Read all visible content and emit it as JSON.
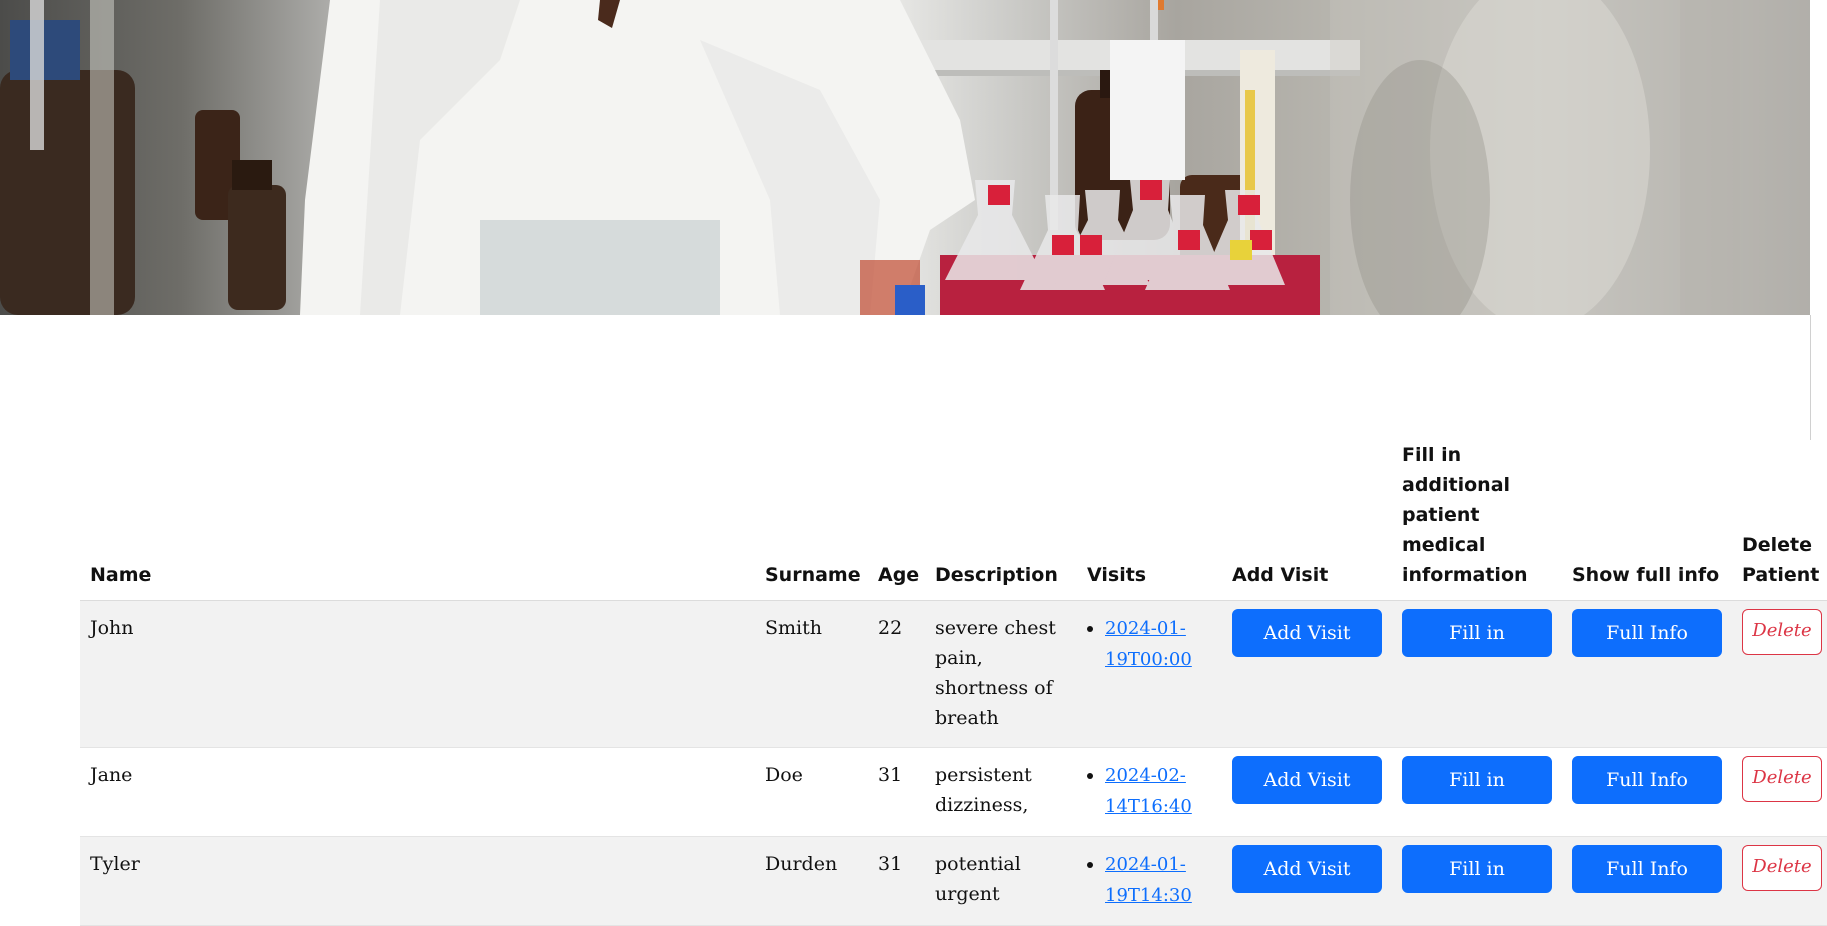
{
  "banner": {
    "alt": "laboratory"
  },
  "table": {
    "headers": {
      "name": "Name",
      "surname": "Surname",
      "age": "Age",
      "description": "Description",
      "visits": "Visits",
      "add_visit": "Add Visit",
      "fill_in": "Fill in additional patient medical information",
      "show_full_info": "Show full info",
      "delete": "Delete Patient"
    },
    "rows": [
      {
        "name": "John",
        "surname": "Smith",
        "age": "22",
        "description": "severe chest pain, shortness of breath",
        "visit": "2024-01-19T00:00",
        "add_visit_label": "Add Visit",
        "fill_in_label": "Fill in",
        "full_info_label": "Full Info",
        "delete_label": "Delete"
      },
      {
        "name": "Jane",
        "surname": "Doe",
        "age": "31",
        "description": "persistent dizziness,",
        "visit": "2024-02-14T16:40",
        "add_visit_label": "Add Visit",
        "fill_in_label": "Fill in",
        "full_info_label": "Full Info",
        "delete_label": "Delete"
      },
      {
        "name": "Tyler",
        "surname": "Durden",
        "age": "31",
        "description": "potential urgent",
        "visit": "2024-01-19T14:30",
        "add_visit_label": "Add Visit",
        "fill_in_label": "Fill in",
        "full_info_label": "Full Info",
        "delete_label": "Delete"
      }
    ]
  },
  "colors": {
    "primary": "#0d6efd",
    "danger": "#dc3545",
    "striped_row": "#f2f2f2"
  }
}
